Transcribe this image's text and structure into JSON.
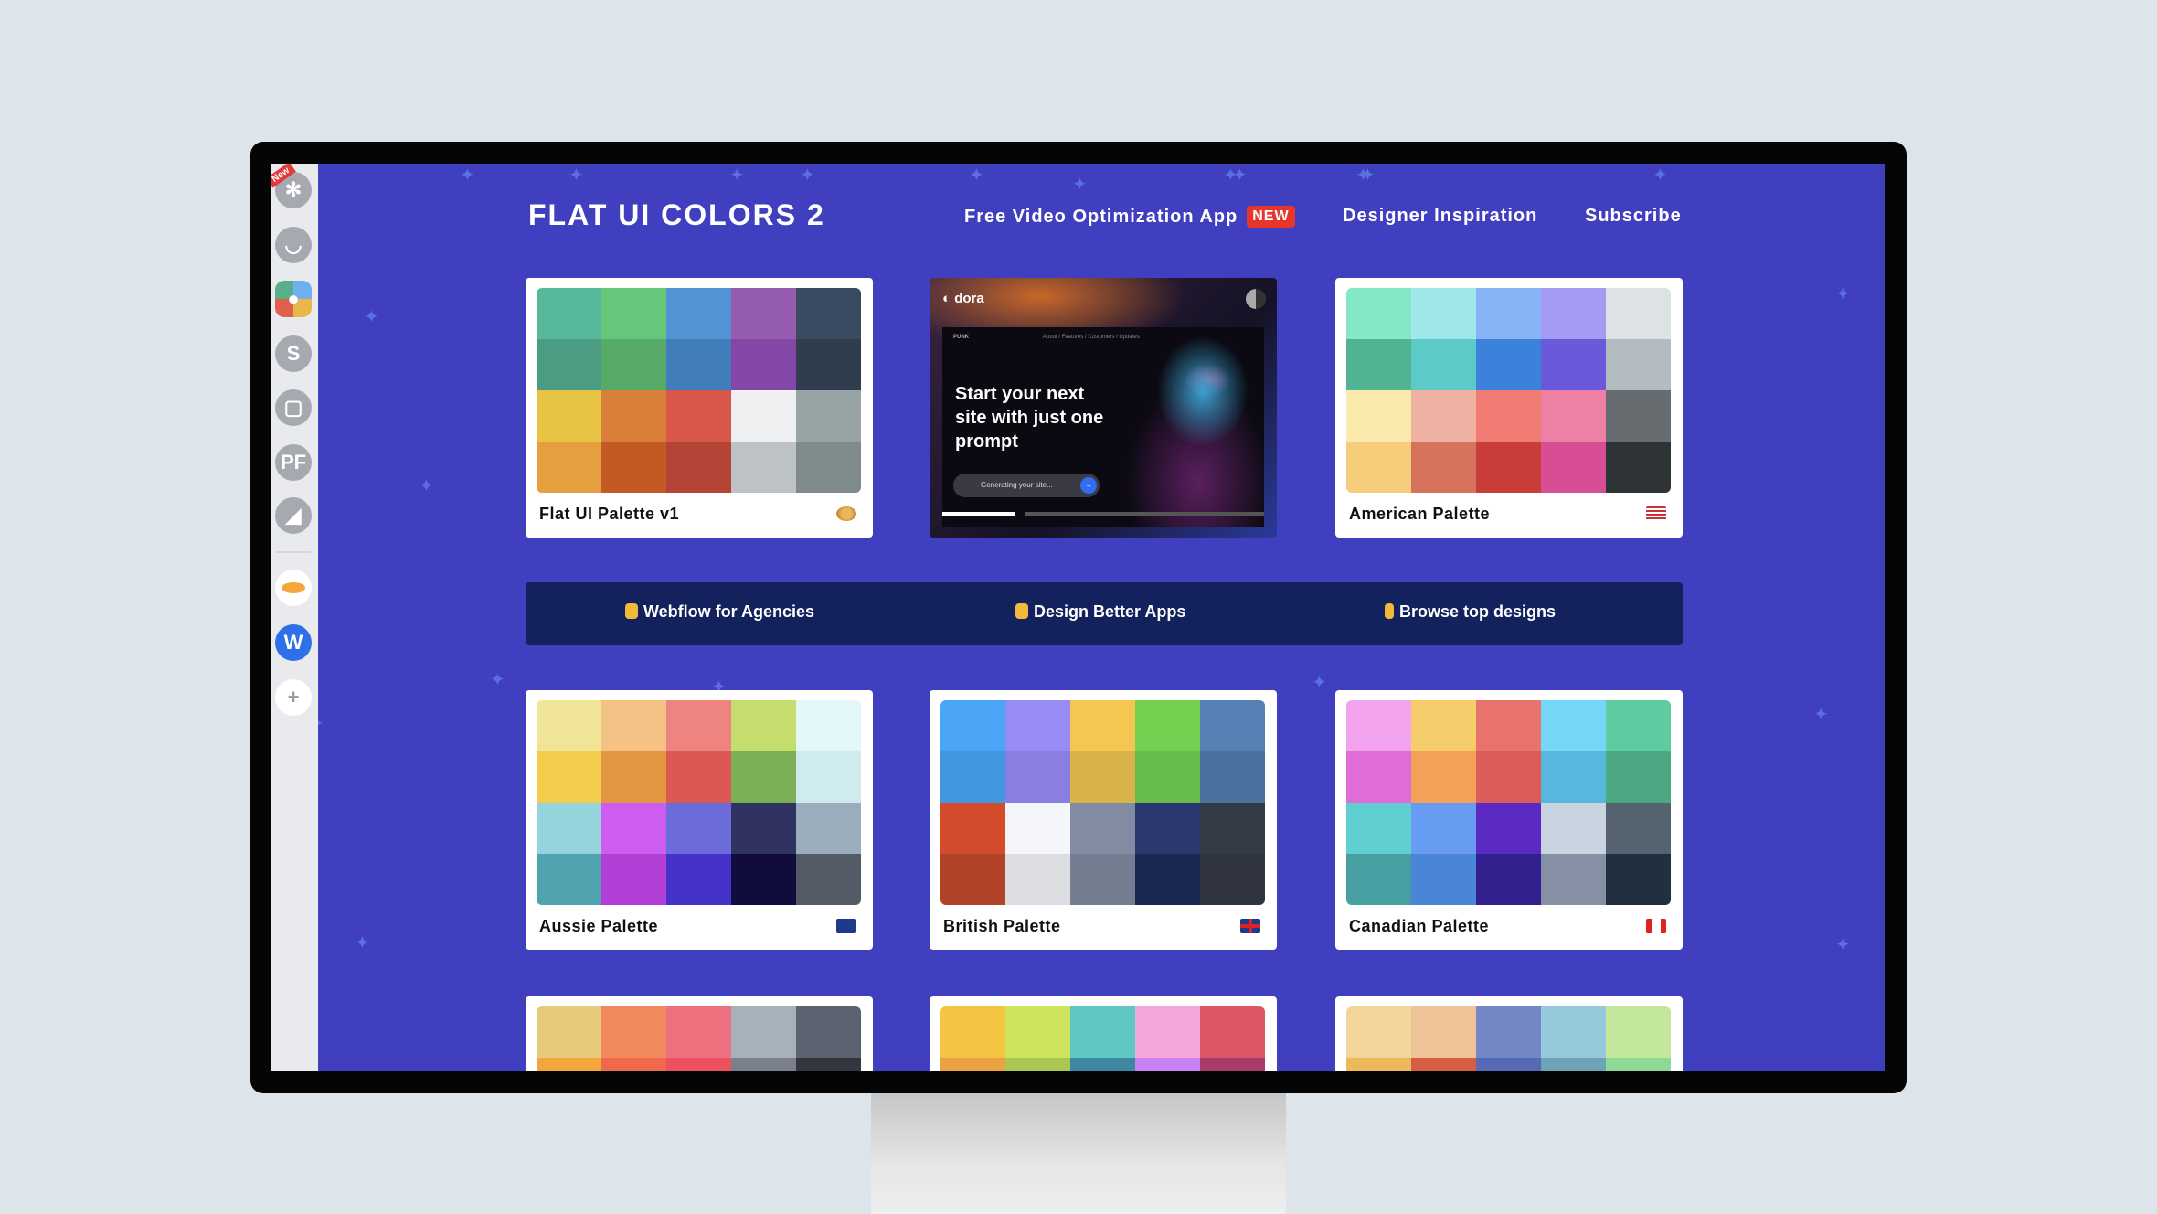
{
  "header": {
    "title": "FLAT UI COLORS 2",
    "nav": [
      {
        "label": "Free Video Optimization App",
        "badge": "NEW"
      },
      {
        "label": "Designer Inspiration"
      },
      {
        "label": "Subscribe"
      }
    ]
  },
  "sidebar": {
    "new_tag": "New",
    "items": [
      {
        "icon": "asterisk-icon",
        "glyph": "✻"
      },
      {
        "icon": "bear-icon",
        "glyph": "◡"
      },
      {
        "icon": "palette-app-icon",
        "glyph": "🎨"
      },
      {
        "icon": "s-icon",
        "glyph": "S"
      },
      {
        "icon": "stack-icon",
        "glyph": "▢"
      },
      {
        "icon": "pf-icon",
        "glyph": "PF"
      },
      {
        "icon": "mountain-icon",
        "glyph": "◢"
      },
      {
        "icon": "zeppelin-icon",
        "glyph": ""
      },
      {
        "icon": "webflow-icon",
        "glyph": "W"
      },
      {
        "icon": "add-icon",
        "glyph": "+"
      }
    ]
  },
  "ad": {
    "brand": "dora",
    "nav_brand": "PUNK",
    "nav_links": "About / Features / Customers / Updates",
    "headline": "Start your next site with just one prompt",
    "input": "Generating your site..."
  },
  "banner": {
    "items": [
      {
        "label": "Webflow for Agencies",
        "icon": "fist-emoji"
      },
      {
        "label": "Design Better Apps",
        "icon": "fist-emoji"
      },
      {
        "label": "Browse top designs",
        "icon": "victory-hand-emoji"
      }
    ]
  },
  "palettes": [
    {
      "name": "Flat UI Palette v1",
      "icon": "palette-emoji",
      "colors": [
        "#58b89c",
        "#66c77a",
        "#5194d3",
        "#955cb0",
        "#3a4a60",
        "#4a9c82",
        "#57ab68",
        "#417dba",
        "#8447a8",
        "#303d4e",
        "#e8c444",
        "#da7f3a",
        "#d8574a",
        "#eff0f1",
        "#98a4a4",
        "#e59f3e",
        "#c35a24",
        "#b44536",
        "#bdc2c5",
        "#7f8b8b"
      ]
    },
    {
      "name": "American Palette",
      "icon": "us-flag",
      "colors": [
        "#84e8c8",
        "#9fe8ea",
        "#86b4f7",
        "#a49cf3",
        "#dde3e5",
        "#52b394",
        "#5ccbc7",
        "#3c82dc",
        "#6b59dc",
        "#b3bcc0",
        "#f9e9ad",
        "#efb2a2",
        "#ef7b73",
        "#ee80a6",
        "#666c70",
        "#f5cc7a",
        "#d6735c",
        "#c93d38",
        "#d84e94",
        "#2e3436"
      ]
    },
    {
      "name": "Aussie Palette",
      "icon": "au-flag",
      "colors": [
        "#f0e596",
        "#f4c284",
        "#ee8380",
        "#c4dd6d",
        "#e3f6f8",
        "#f3cd4c",
        "#e2963f",
        "#dc5853",
        "#7bb056",
        "#cfebed",
        "#95d3dd",
        "#cd5cf0",
        "#6b6bd9",
        "#303262",
        "#9aadbd",
        "#4fa4b0",
        "#b13ed7",
        "#4432c9",
        "#110c3e",
        "#545a66"
      ]
    },
    {
      "name": "British Palette",
      "icon": "uk-flag",
      "colors": [
        "#4aa5f7",
        "#978bf5",
        "#f4c753",
        "#72cf50",
        "#5581b4",
        "#4297e0",
        "#8a7fe0",
        "#d9b24a",
        "#68bc49",
        "#4b729f",
        "#d34d2c",
        "#f5f6fa",
        "#818ca3",
        "#2b386f",
        "#353a47",
        "#b24329",
        "#dcdde1",
        "#737f91",
        "#1c2854",
        "#30353f"
      ]
    },
    {
      "name": "Canadian Palette",
      "icon": "ca-flag",
      "colors": [
        "#f1a3ee",
        "#f5cd6b",
        "#e9726d",
        "#75d7f5",
        "#5fcba0",
        "#e06cd7",
        "#f3a158",
        "#dc5c58",
        "#56b8de",
        "#4ca882",
        "#5fcfd1",
        "#689cf2",
        "#5b29c3",
        "#cad4e0",
        "#556270",
        "#479fa1",
        "#4a85d6",
        "#33208f",
        "#8590a4",
        "#222f3e"
      ]
    },
    {
      "name": "",
      "colors": [
        "#e7ca7a",
        "#f08a5d",
        "#ee7180",
        "#a7b1bc",
        "#5c6270",
        "#f2a73c",
        "#ef6a4d",
        "#ec525e",
        "#7a7f8b",
        "#32363f"
      ]
    },
    {
      "name": "",
      "colors": [
        "#f5c443",
        "#cde55c",
        "#5fc8c2",
        "#f2a9d9",
        "#db5767",
        "#eaa342",
        "#a9c752",
        "#3e86a2",
        "#c781f2",
        "#a83a6c"
      ]
    },
    {
      "name": "",
      "colors": [
        "#f3d59a",
        "#efc398",
        "#7287c4",
        "#95c8db",
        "#c4e79e",
        "#ecb95b",
        "#d55f43",
        "#5569b5",
        "#6ea2b7",
        "#8ed993"
      ]
    }
  ],
  "colors": {
    "background": "#3f3fbf",
    "banner": "#13215c",
    "new_badge": "#e8352b"
  }
}
